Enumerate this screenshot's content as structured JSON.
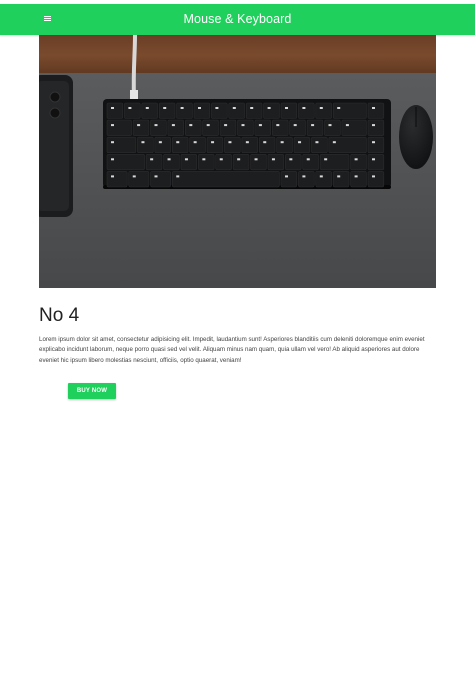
{
  "appbar": {
    "title": "Mouse & Keyboard",
    "menu_icon": "hamburger-menu-icon",
    "color": "#1fd15c"
  },
  "product": {
    "image_subject": "mechanical keyboard, mouse and phone on a grey desk mat over a wooden table",
    "heading": "No 4",
    "description": "Lorem ipsum dolor sit amet, consectetur adipisicing elit. Impedit, laudantium sunt! Asperiores blanditiis cum deleniti doloremque enim eveniet explicabo incidunt laborum, neque porro quasi sed vel velit. Aliquam minus nam quam, quia ullam vel vero! Ab aliquid asperiores aut dolore eveniet hic ipsum libero molestias nesciunt, officiis, optio quaerat, veniam!",
    "buy_label": "Buy Now"
  }
}
